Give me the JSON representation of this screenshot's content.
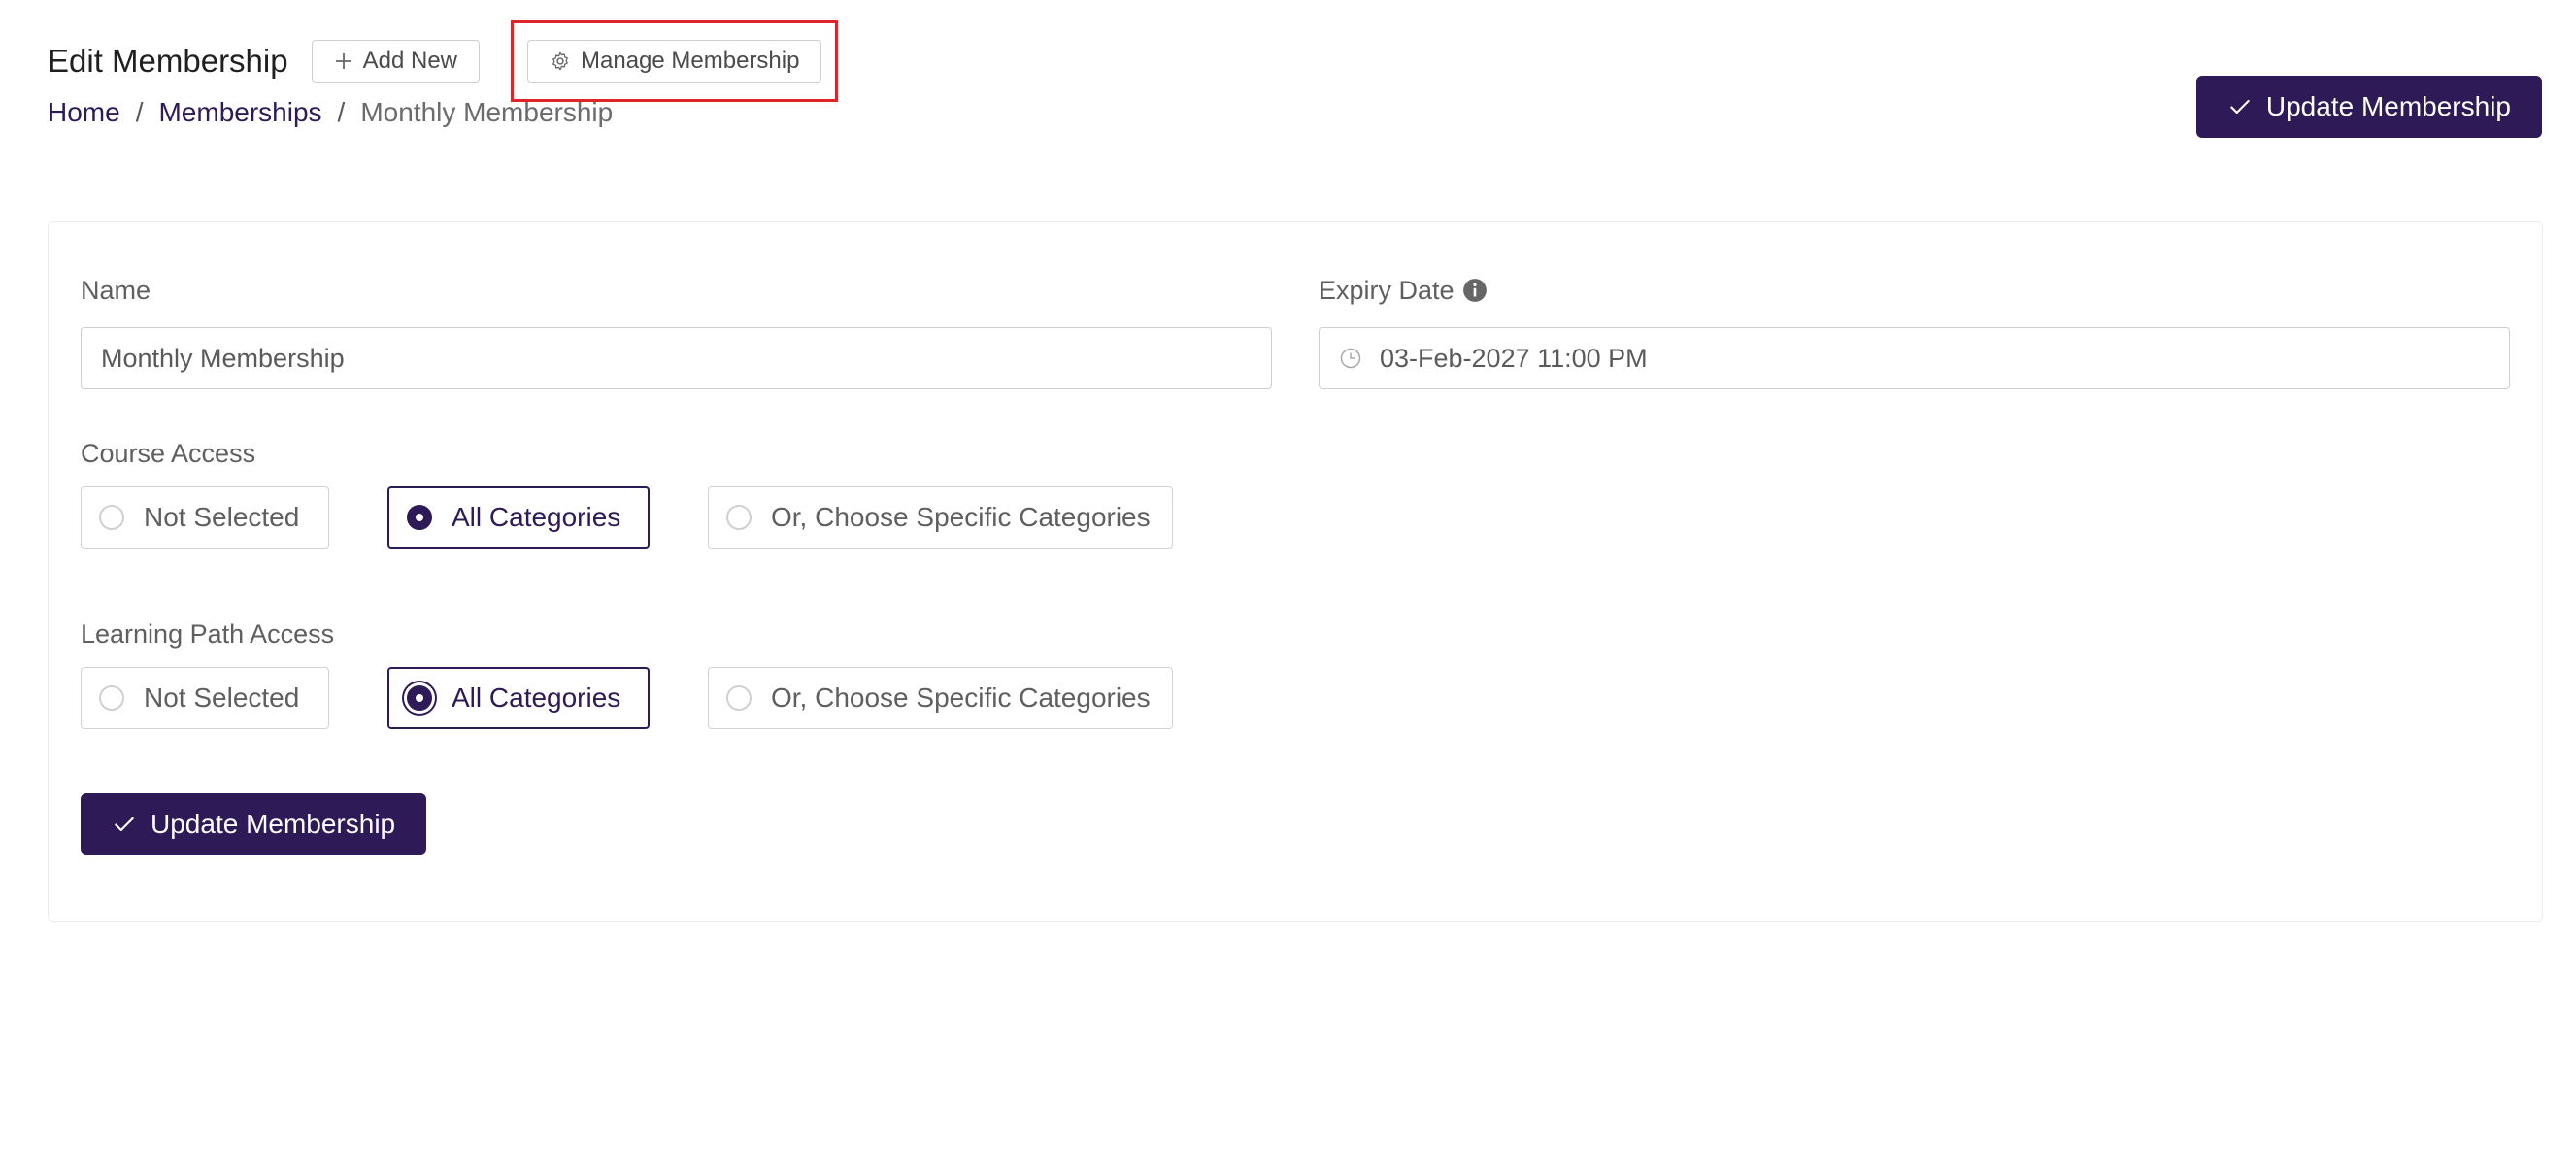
{
  "header": {
    "title": "Edit Membership",
    "add_new_label": "Add New",
    "manage_label": "Manage Membership",
    "update_label": "Update Membership"
  },
  "breadcrumb": {
    "home": "Home",
    "memberships": "Memberships",
    "current": "Monthly Membership",
    "separator": "/"
  },
  "form": {
    "name_label": "Name",
    "name_value": "Monthly Membership",
    "expiry_label": "Expiry Date",
    "expiry_value": "03-Feb-2027 11:00 PM",
    "course_access": {
      "label": "Course Access",
      "options": [
        "Not Selected",
        "All Categories",
        "Or, Choose Specific Categories"
      ],
      "selected": "All Categories"
    },
    "learning_path_access": {
      "label": "Learning Path Access",
      "options": [
        "Not Selected",
        "All Categories",
        "Or, Choose Specific Categories"
      ],
      "selected": "All Categories"
    },
    "submit_label": "Update Membership"
  },
  "colors": {
    "primary": "#2e1a57",
    "highlight": "#e0242a",
    "border": "#cfcfcf"
  },
  "icons": {
    "add_new": "plus-icon",
    "manage": "gear-icon",
    "update": "check-icon",
    "expiry_info": "info-icon",
    "expiry_input": "clock-icon"
  }
}
